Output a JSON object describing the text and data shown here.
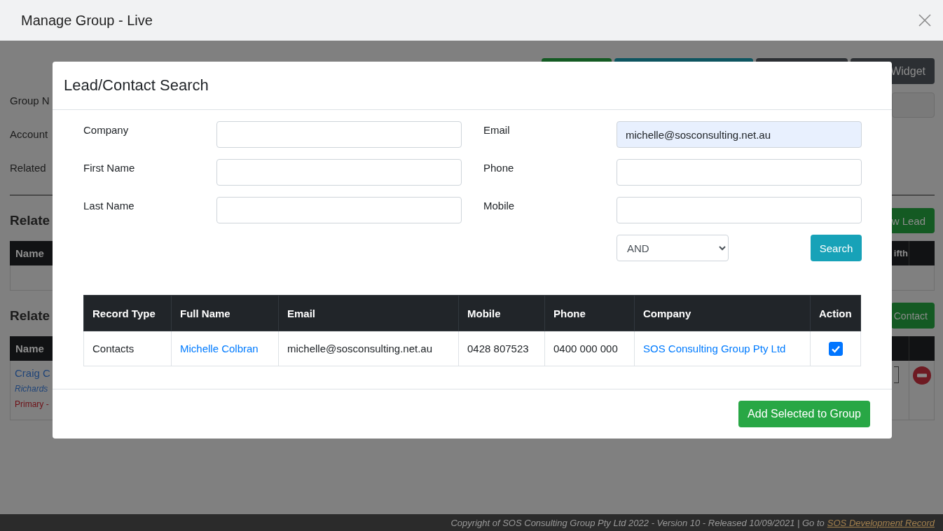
{
  "window": {
    "title": "Manage Group - Live"
  },
  "background": {
    "toolbar_buttons": [
      {
        "kind": "success"
      },
      {
        "kind": "info"
      },
      {
        "kind": "dark"
      },
      {
        "kind": "dark",
        "label": "Widget"
      }
    ],
    "form_labels": [
      "Group N",
      "Account",
      "Related"
    ],
    "sections": [
      {
        "heading": "Relate",
        "button": "w Lead",
        "first_column": "Name",
        "last_column": "ifth"
      },
      {
        "heading": "Relate",
        "button": "Contact",
        "first_column": "Name",
        "rows": [
          {
            "name": "Craig C",
            "company": "Richards",
            "role": "Primary -",
            "removable": true
          }
        ]
      }
    ]
  },
  "modal": {
    "title": "Lead/Contact Search",
    "fields_left": [
      {
        "label": "Company"
      },
      {
        "label": "First Name"
      },
      {
        "label": "Last Name"
      }
    ],
    "fields_right": [
      {
        "label": "Email",
        "value": "michelle@sosconsulting.net.au",
        "autofilled": true
      },
      {
        "label": "Phone"
      },
      {
        "label": "Mobile"
      }
    ],
    "operator": "AND",
    "search_button": "Search",
    "results": {
      "columns": [
        "Record Type",
        "Full Name",
        "Email",
        "Mobile",
        "Phone",
        "Company",
        "Action"
      ],
      "rows": [
        {
          "cells": [
            {
              "kind": "text",
              "text": "Contacts"
            },
            {
              "kind": "link",
              "text": "Michelle Colbran"
            },
            {
              "kind": "text",
              "text": "michelle@sosconsulting.net.au"
            },
            {
              "kind": "text",
              "text": "0428 807523"
            },
            {
              "kind": "text",
              "text": "0400 000 000"
            },
            {
              "kind": "link",
              "text": "SOS Consulting Group Pty Ltd"
            }
          ],
          "checked": true
        }
      ]
    },
    "add_button": "Add Selected to Group"
  },
  "footer": {
    "text": "Copyright of SOS Consulting Group Pty Ltd 2022 - Version 10 - Released 10/09/2021 | Go to",
    "link": "SOS Development Record"
  }
}
